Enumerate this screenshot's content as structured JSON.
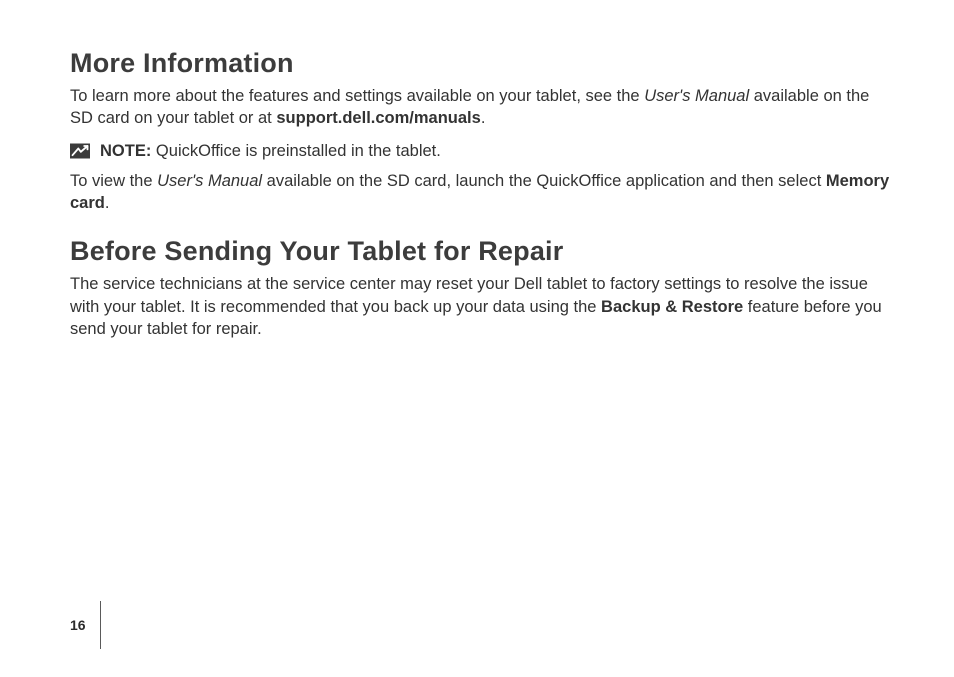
{
  "page_number": "16",
  "section1": {
    "heading": "More Information",
    "p1_a": "To learn more about the features and settings available on your tablet, see the ",
    "p1_b_italic": "User's Manual",
    "p1_c": " available on the SD card on your tablet or at ",
    "p1_d_bold": "support.dell.com/manuals",
    "p1_e": ".",
    "note_label": "NOTE:",
    "note_text": " QuickOffice is preinstalled in the tablet.",
    "p2_a": "To view the ",
    "p2_b_italic": "User's Manual",
    "p2_c": " available on the SD card, launch the QuickOffice application and then select ",
    "p2_d_bold": "Memory card",
    "p2_e": "."
  },
  "section2": {
    "heading": "Before Sending Your Tablet for Repair",
    "p1_a": "The service technicians at the service center may reset your Dell tablet to factory settings to resolve the issue with your tablet. It is recommended that you back up your data using the ",
    "p1_b_bold": "Backup & Restore",
    "p1_c": " feature before you send your tablet for repair."
  }
}
